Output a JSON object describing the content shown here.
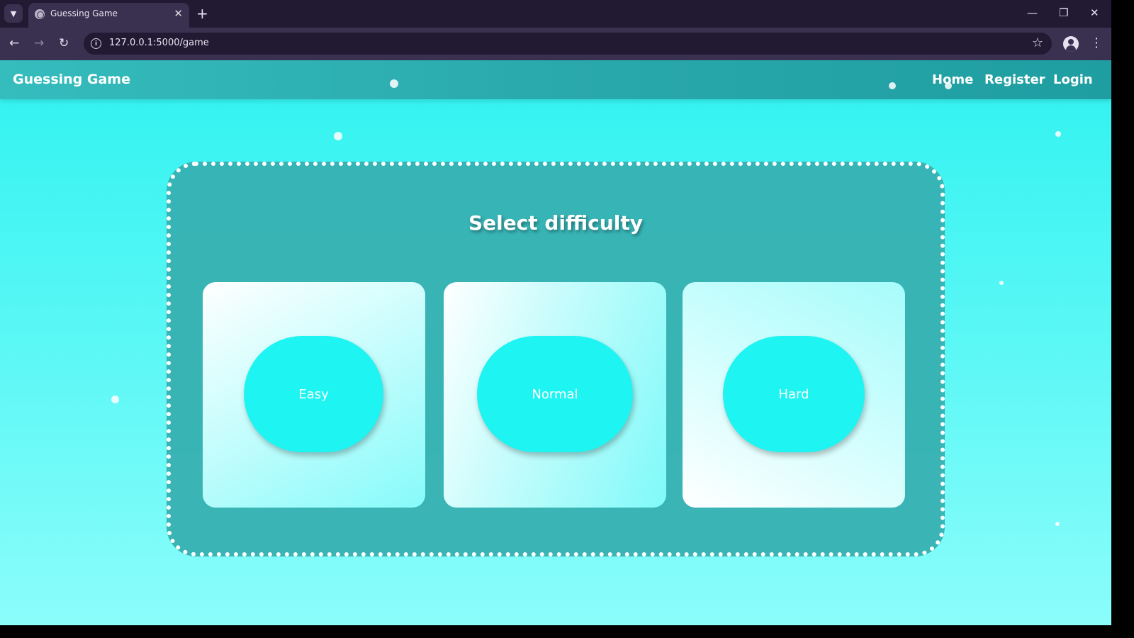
{
  "browser": {
    "tab_title": "Guessing Game",
    "url": "127.0.0.1:5000/game",
    "icons": {
      "tab_menu": "chevron-down-icon",
      "favicon": "globe-icon",
      "tab_close": "close-icon",
      "new_tab": "plus-icon",
      "back": "back-arrow-icon",
      "forward": "forward-arrow-icon",
      "reload": "reload-icon",
      "site_info": "info-icon",
      "bookmark": "star-icon",
      "profile": "profile-icon",
      "menu": "kebab-menu-icon",
      "minimize": "minimize-icon",
      "restore": "restore-icon",
      "close_window": "close-icon"
    }
  },
  "navbar": {
    "brand": "Guessing Game",
    "links": [
      "Home",
      "Register",
      "Login"
    ]
  },
  "main": {
    "title": "Select difficulty",
    "difficulties": [
      "Easy",
      "Normal",
      "Hard"
    ]
  },
  "colors": {
    "chrome_dark": "#221a33",
    "chrome_toolbar": "#3a3150",
    "navbar": "#2aa9ac",
    "page_bg": "#2ff2f0",
    "panel": "#37b0b1",
    "button": "#1ef4f2"
  }
}
